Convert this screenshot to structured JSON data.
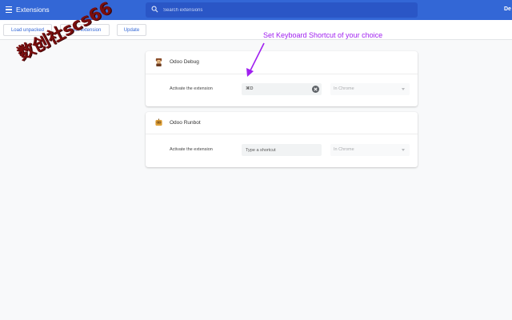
{
  "header": {
    "title": "Extensions",
    "search_placeholder": "Search extensions",
    "user_label": "De"
  },
  "toolbar": {
    "load_unpacked": "Load unpacked",
    "pack_extension": "Pack extension",
    "update": "Update"
  },
  "extensions": [
    {
      "name": "Odoo Debug",
      "row_label": "Activate the extension",
      "shortcut_value": "⌘D",
      "scope": "In Chrome"
    },
    {
      "name": "Odoo Runbot",
      "row_label": "Activate the extension",
      "shortcut_placeholder": "Type a shortcut",
      "scope": "In Chrome"
    }
  ],
  "annotation": "Set Keyboard Shortcut of your choice",
  "watermark": "数创社scs66",
  "colors": {
    "topbar": "#3367d6",
    "search_bg": "#2a56c6",
    "annotation": "#a020f0",
    "watermark": "#7a0e0e"
  }
}
